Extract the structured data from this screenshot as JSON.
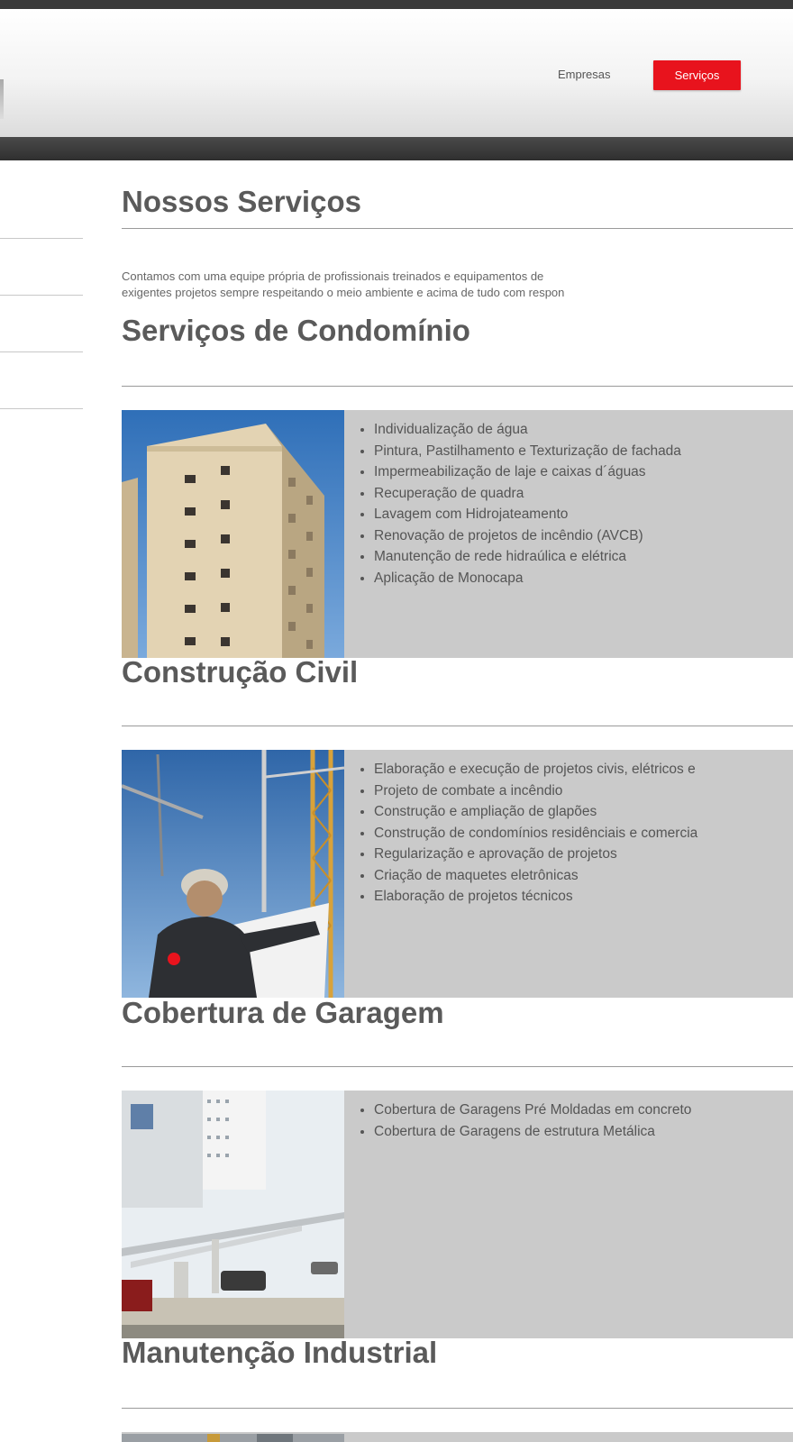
{
  "header": {
    "nav": {
      "empresas_label": "Empresas",
      "servicos_label": "Serviços"
    },
    "colors": {
      "active_nav": "#e8131d",
      "list_panel": "#cacaca"
    }
  },
  "main": {
    "title": "Nossos Serviços",
    "intro_lines": [
      "Contamos com uma equipe própria de profissionais treinados e equipamentos de",
      "exigentes projetos sempre respeitando o meio ambiente e acima de tudo com respon"
    ],
    "sections": [
      {
        "title": "Serviços de Condomínio",
        "image": "apartment-building-photo",
        "items": [
          "Individualização de água",
          "Pintura, Pastilhamento e Texturização de fachada",
          "Impermeabilização de laje e caixas d´águas",
          "Recuperação de quadra",
          "Lavagem com Hidrojateamento",
          "Renovação de projetos de incêndio (AVCB)",
          "Manutenção de rede hidraúlica e elétrica",
          "Aplicação de Monocapa"
        ]
      },
      {
        "title": "Construção Civil",
        "image": "construction-engineer-photo",
        "items": [
          "Elaboração e execução de projetos civis, elétricos e",
          "Projeto de combate a incêndio",
          "Construção e ampliação de glapões",
          "Construção de condomínios residênciais e comercia",
          "Regularização e aprovação de projetos",
          "Criação de maquetes eletrônicas",
          "Elaboração de projetos técnicos"
        ]
      },
      {
        "title": "Cobertura de Garagem",
        "image": "garage-cover-photo",
        "items": [
          "Cobertura de Garagens Pré Moldadas em concreto",
          "Cobertura de Garagens de estrutura Metálica"
        ]
      },
      {
        "title": "Manutenção Industrial",
        "image": "industrial-photo",
        "items": []
      }
    ]
  }
}
